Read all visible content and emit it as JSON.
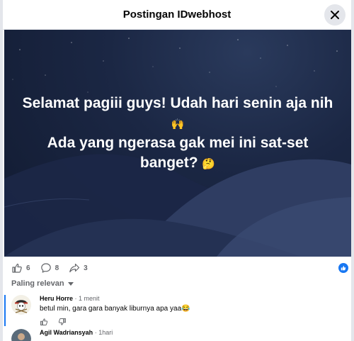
{
  "dialog": {
    "title": "Postingan IDwebhost",
    "close_icon": "close-icon"
  },
  "post": {
    "text_line1": "Selamat pagiii guys! Udah hari senin aja nih",
    "emoji1": "🙌",
    "text_line2": "Ada yang ngerasa gak mei ini sat-set",
    "text_line3": "banget?",
    "emoji2": "🤔"
  },
  "actions": {
    "likes": "6",
    "comments": "8",
    "shares": "3",
    "like_icon": "thumbs-up-icon",
    "comment_icon": "comment-bubble-icon",
    "share_icon": "share-arrow-icon",
    "badge_icon": "like-badge-icon"
  },
  "sort": {
    "label": "Paling relevan"
  },
  "comments": [
    {
      "name": "Heru Horre",
      "time": "1 menit",
      "text": "betul min, gara gara banyak liburnya apa yaa😂"
    },
    {
      "name": "Agil Wadriansyah",
      "time": "1hari",
      "text": ""
    }
  ],
  "colors": {
    "accent": "#1877f2",
    "muted": "#65676b",
    "divider": "#e4e6eb"
  }
}
